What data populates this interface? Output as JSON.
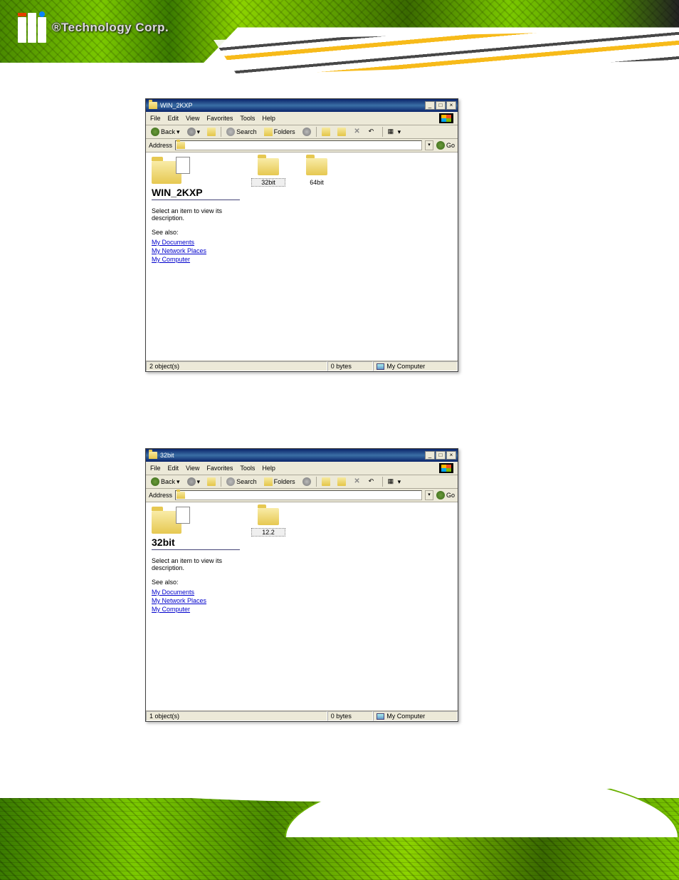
{
  "logo_text": "®Technology Corp.",
  "menu": {
    "file": "File",
    "edit": "Edit",
    "view": "View",
    "favorites": "Favorites",
    "tools": "Tools",
    "help": "Help"
  },
  "toolbar": {
    "back": "Back",
    "search": "Search",
    "folders": "Folders",
    "go": "Go"
  },
  "address_label": "Address",
  "leftpanel": {
    "desc": "Select an item to view its description.",
    "see_also": "See also:",
    "links": {
      "docs": "My Documents",
      "net": "My Network Places",
      "comp": "My Computer"
    }
  },
  "win1": {
    "title": "WIN_2KXP",
    "folder_title": "WIN_2KXP",
    "items": {
      "a": "32bit",
      "b": "64bit"
    },
    "status_objects": "2 object(s)",
    "status_bytes": "0 bytes",
    "status_loc": "My Computer"
  },
  "win2": {
    "title": "32bit",
    "folder_title": "32bit",
    "items": {
      "a": "12.2"
    },
    "status_objects": "1 object(s)",
    "status_bytes": "0 bytes",
    "status_loc": "My Computer"
  }
}
